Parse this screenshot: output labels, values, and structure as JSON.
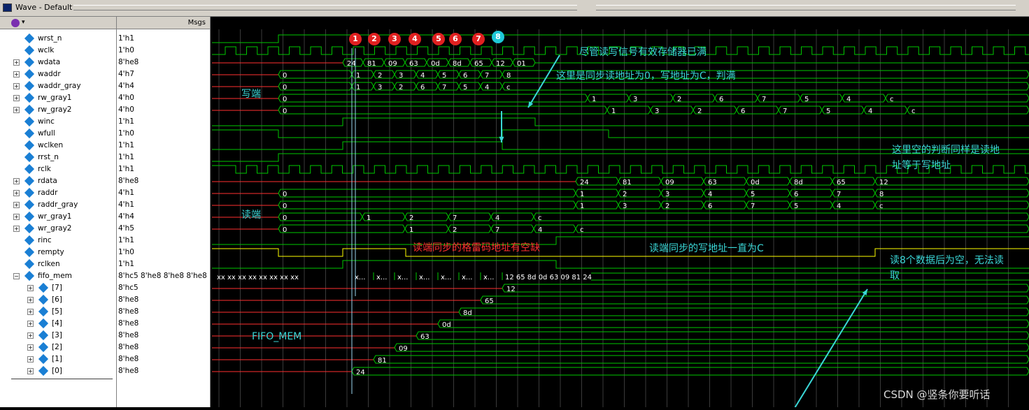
{
  "window": {
    "title": "Wave - Default"
  },
  "headers": {
    "msgs": "Msgs"
  },
  "signals": [
    {
      "name": "wrst_n",
      "value": "1'h1",
      "bus": false
    },
    {
      "name": "wclk",
      "value": "1'h0",
      "bus": false
    },
    {
      "name": "wdata",
      "value": "8'he8",
      "bus": true
    },
    {
      "name": "waddr",
      "value": "4'h7",
      "bus": true
    },
    {
      "name": "waddr_gray",
      "value": "4'h4",
      "bus": true
    },
    {
      "name": "rw_gray1",
      "value": "4'h0",
      "bus": true
    },
    {
      "name": "rw_gray2",
      "value": "4'h0",
      "bus": true
    },
    {
      "name": "winc",
      "value": "1'h1",
      "bus": false
    },
    {
      "name": "wfull",
      "value": "1'h0",
      "bus": false
    },
    {
      "name": "wclken",
      "value": "1'h1",
      "bus": false
    },
    {
      "name": "rrst_n",
      "value": "1'h1",
      "bus": false
    },
    {
      "name": "rclk",
      "value": "1'h1",
      "bus": false
    },
    {
      "name": "rdata",
      "value": "8'he8",
      "bus": true
    },
    {
      "name": "raddr",
      "value": "4'h1",
      "bus": true
    },
    {
      "name": "raddr_gray",
      "value": "4'h1",
      "bus": true
    },
    {
      "name": "wr_gray1",
      "value": "4'h4",
      "bus": true
    },
    {
      "name": "wr_gray2",
      "value": "4'h5",
      "bus": true
    },
    {
      "name": "rinc",
      "value": "1'h1",
      "bus": false
    },
    {
      "name": "rempty",
      "value": "1'h0",
      "bus": false
    },
    {
      "name": "rclken",
      "value": "1'h1",
      "bus": false
    },
    {
      "name": "fifo_mem",
      "value": "8'hc5 8'he8 8'he8 8'he8 ...",
      "bus": true,
      "expanded": true
    },
    {
      "name": "[7]",
      "value": "8'hc5",
      "bus": true,
      "child": true
    },
    {
      "name": "[6]",
      "value": "8'he8",
      "bus": true,
      "child": true
    },
    {
      "name": "[5]",
      "value": "8'he8",
      "bus": true,
      "child": true
    },
    {
      "name": "[4]",
      "value": "8'he8",
      "bus": true,
      "child": true,
      "selected": true
    },
    {
      "name": "[3]",
      "value": "8'he8",
      "bus": true,
      "child": true
    },
    {
      "name": "[2]",
      "value": "8'he8",
      "bus": true,
      "child": true
    },
    {
      "name": "[1]",
      "value": "8'he8",
      "bus": true,
      "child": true
    },
    {
      "name": "[0]",
      "value": "8'he8",
      "bus": true,
      "child": true
    }
  ],
  "bus_values": {
    "wdata": [
      "24",
      "81",
      "09",
      "63",
      "0d",
      "8d",
      "65",
      "12",
      "01"
    ],
    "waddr": [
      "0",
      "1",
      "2",
      "3",
      "4",
      "5",
      "6",
      "7",
      "8"
    ],
    "waddr_gray": [
      "0",
      "1",
      "3",
      "2",
      "6",
      "7",
      "5",
      "4",
      "c"
    ],
    "rw_gray1": [
      "0",
      "1",
      "3",
      "2",
      "6",
      "7",
      "5",
      "4",
      "c"
    ],
    "rw_gray2": [
      "0",
      "1",
      "3",
      "2",
      "6",
      "7",
      "5",
      "4",
      "c"
    ],
    "rdata": [
      "24",
      "81",
      "09",
      "63",
      "0d",
      "8d",
      "65",
      "12"
    ],
    "raddr": [
      "0",
      "1",
      "2",
      "3",
      "4",
      "5",
      "6",
      "7",
      "8"
    ],
    "raddr_gray": [
      "0",
      "1",
      "3",
      "2",
      "6",
      "7",
      "5",
      "4",
      "c"
    ],
    "wr_gray1": [
      "0",
      "1",
      "2",
      "7",
      "4",
      "c"
    ],
    "wr_gray2": [
      "0",
      "1",
      "2",
      "7",
      "4",
      "c"
    ],
    "fifo_mem_x": "xx xx xx xx xx xx xx xx",
    "fifo_mem_xs": [
      "x...",
      "x...",
      "x...",
      "x...",
      "x...",
      "x...",
      "x..."
    ],
    "fifo_mem_final": "12 65 8d 0d 63 09 81 24",
    "mem": [
      "24",
      "81",
      "09",
      "63",
      "0d",
      "8d",
      "65",
      "12"
    ]
  },
  "markers": [
    "1",
    "2",
    "3",
    "4",
    "5",
    "6",
    "7",
    "8"
  ],
  "annotations": {
    "full_despite": "尽管读写信号有效存储器已满",
    "sync_full": "这里是同步读地址为0，写地址为C，判满",
    "write_side": "写端",
    "empty_judge_1": "这里空的判断同样是读地",
    "empty_judge_2": "址等于写地址",
    "read_side": "读端",
    "gray_gap": "读端同步的格雷码地址有空缺",
    "sync_write_c": "读端同步的写地址一直为C",
    "empty_after_1": "读8个数据后为空，无法读",
    "empty_after_2": "取",
    "fifo_mem_label": "FIFO_MEM",
    "watermark": "CSDN @竖条你要听话"
  },
  "colors": {
    "wave": "#00c800",
    "red": "#ff3030",
    "yellow": "#ffff00",
    "cyan": "#3ad6d6",
    "marker_red": "#e02020",
    "marker_cyan": "#1ec8d8"
  }
}
